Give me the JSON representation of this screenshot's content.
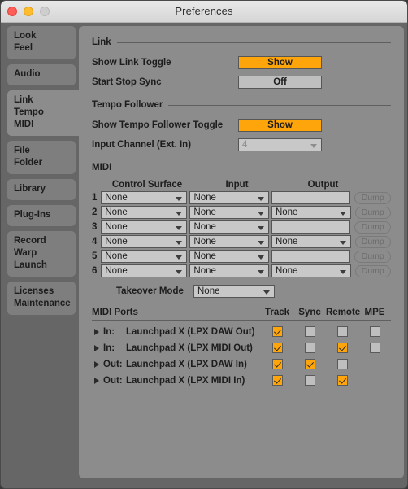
{
  "window": {
    "title": "Preferences",
    "traffic_lights": [
      "close-button",
      "minimize-button",
      "zoom-button"
    ],
    "colors": {
      "accent_orange": "#ffa50c",
      "panel_bg": "#8c8c8c",
      "sidebar_bg": "#666666",
      "field_bg": "#c8c8c8"
    }
  },
  "sidebar": {
    "groups": [
      {
        "selected": false,
        "lines": [
          "Look",
          "Feel"
        ]
      },
      {
        "selected": false,
        "lines": [
          "Audio"
        ]
      },
      {
        "selected": true,
        "lines": [
          "Link",
          "Tempo",
          "MIDI"
        ]
      },
      {
        "selected": false,
        "lines": [
          "File",
          "Folder"
        ]
      },
      {
        "selected": false,
        "lines": [
          "Library"
        ]
      },
      {
        "selected": false,
        "lines": [
          "Plug-Ins"
        ]
      },
      {
        "selected": false,
        "lines": [
          "Record",
          "Warp",
          "Launch"
        ]
      },
      {
        "selected": false,
        "lines": [
          "Licenses",
          "Maintenance"
        ]
      }
    ]
  },
  "link": {
    "heading": "Link",
    "show_link_toggle": {
      "label": "Show Link Toggle",
      "value": "Show",
      "state": "on"
    },
    "start_stop_sync": {
      "label": "Start Stop Sync",
      "value": "Off",
      "state": "off"
    }
  },
  "tempo_follower": {
    "heading": "Tempo Follower",
    "show_toggle": {
      "label": "Show Tempo Follower Toggle",
      "value": "Show",
      "state": "on"
    },
    "input_channel": {
      "label": "Input Channel (Ext. In)",
      "value": "4",
      "disabled": true
    }
  },
  "midi": {
    "heading": "MIDI",
    "columns": [
      "Control Surface",
      "Input",
      "Output"
    ],
    "dump_label": "Dump",
    "rows": [
      {
        "index": "1",
        "control_surface": "None",
        "input": "None",
        "output": "",
        "output_is_dropdown": false
      },
      {
        "index": "2",
        "control_surface": "None",
        "input": "None",
        "output": "None",
        "output_is_dropdown": true
      },
      {
        "index": "3",
        "control_surface": "None",
        "input": "None",
        "output": "",
        "output_is_dropdown": false
      },
      {
        "index": "4",
        "control_surface": "None",
        "input": "None",
        "output": "None",
        "output_is_dropdown": true
      },
      {
        "index": "5",
        "control_surface": "None",
        "input": "None",
        "output": "",
        "output_is_dropdown": false
      },
      {
        "index": "6",
        "control_surface": "None",
        "input": "None",
        "output": "None",
        "output_is_dropdown": true
      }
    ],
    "takeover_mode": {
      "label": "Takeover Mode",
      "value": "None"
    }
  },
  "midi_ports": {
    "heading": "MIDI Ports",
    "columns": [
      "Track",
      "Sync",
      "Remote",
      "MPE"
    ],
    "rows": [
      {
        "direction": "In:",
        "name": "Launchpad X (LPX DAW Out)",
        "track": true,
        "sync": false,
        "remote": false,
        "mpe": false,
        "has_mpe": true
      },
      {
        "direction": "In:",
        "name": "Launchpad X (LPX MIDI Out)",
        "track": true,
        "sync": false,
        "remote": true,
        "mpe": false,
        "has_mpe": true
      },
      {
        "direction": "Out:",
        "name": "Launchpad X (LPX DAW In)",
        "track": true,
        "sync": true,
        "remote": false,
        "mpe": false,
        "has_mpe": false
      },
      {
        "direction": "Out:",
        "name": "Launchpad X (LPX MIDI In)",
        "track": true,
        "sync": false,
        "remote": true,
        "mpe": false,
        "has_mpe": false
      }
    ]
  }
}
